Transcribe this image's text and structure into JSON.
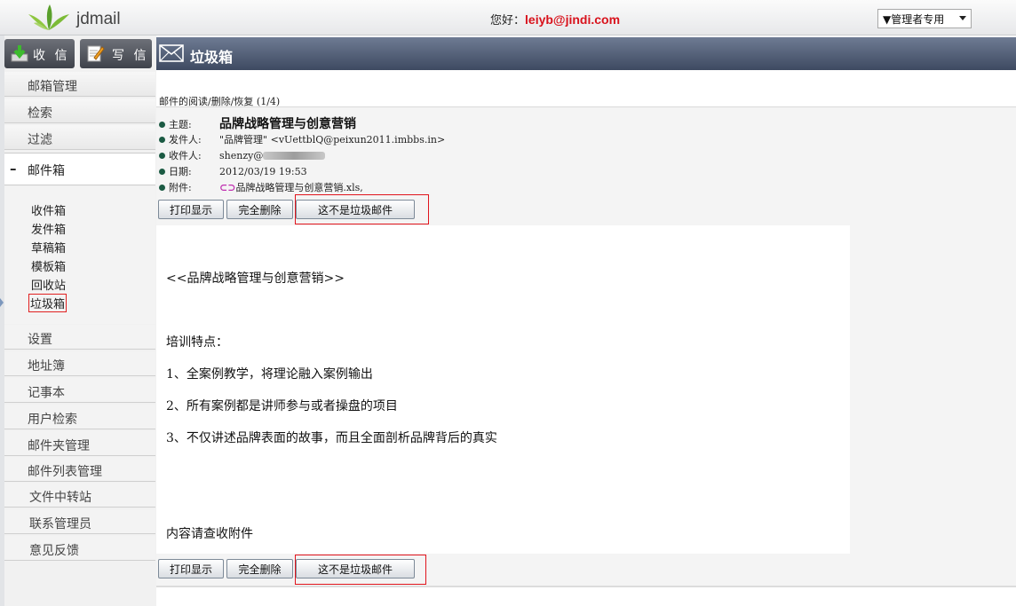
{
  "app": {
    "logo_text": "jdmail"
  },
  "header": {
    "greeting_label": "您好：",
    "user_email": "leiyb@jindi.com",
    "admin_select": "▼管理者专用"
  },
  "sidebar": {
    "receive_label": "收 信",
    "write_label": "写 信",
    "menu_top": [
      "邮箱管理",
      "检索",
      "过滤"
    ],
    "mailbox_label": "邮件箱",
    "mailbox_toggle": "–",
    "folders": [
      "收件箱",
      "发件箱",
      "草稿箱",
      "模板箱",
      "回收站",
      "垃圾箱"
    ],
    "menu_bottom": [
      "设置",
      "地址簿",
      "记事本",
      "用户检索",
      "邮件夹管理",
      "邮件列表管理",
      "文件中转站",
      "联系管理员",
      "意见反馈"
    ]
  },
  "banner": {
    "title": "垃圾箱"
  },
  "message": {
    "action_label": "邮件的阅读/删除/恢复  (1/4)",
    "subject_label": "主题:",
    "subject": "品牌战略管理与创意营销",
    "from_label": "发件人:",
    "from": "\"品牌管理\" <vUettblQ@peixun2011.imbbs.in>",
    "to_label": "收件人:",
    "to": "shenzy@",
    "date_label": "日期:",
    "date": "2012/03/19 19:53",
    "attach_label": "附件:",
    "attachment": "品牌战略管理与创意营销.xls,",
    "buttons": {
      "print": "打印显示",
      "delete": "完全删除",
      "not_spam": "这不是垃圾邮件"
    },
    "body": [
      "<<品牌战略管理与创意营销>>",
      "培训特点：",
      "1、全案例教学，将理论融入案例输出",
      "2、所有案例都是讲师参与或者操盘的项目",
      "3、不仅讲述品牌表面的故事，而且全面剖析品牌背后的真实",
      "内容请查收附件"
    ]
  }
}
